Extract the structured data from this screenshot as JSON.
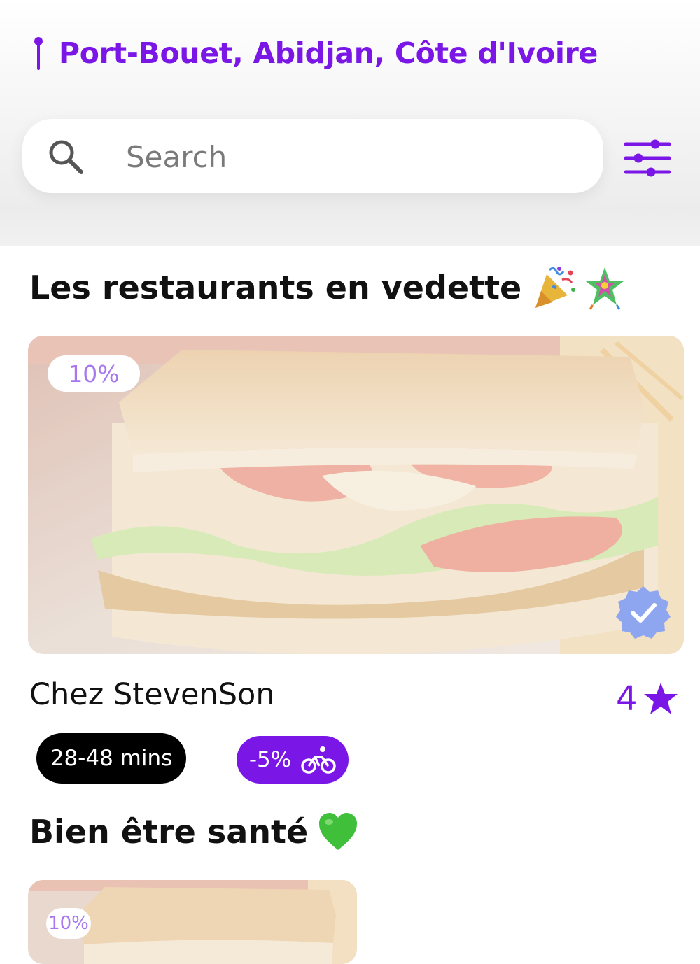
{
  "header": {
    "location": "Port-Bouet, Abidjan, Côte d'Ivoire",
    "location_icon": "pin-icon",
    "accent_color": "#7a16e6"
  },
  "search": {
    "placeholder": "Search",
    "value": "",
    "icon": "search-icon",
    "filter_icon": "sliders-icon"
  },
  "sections": [
    {
      "title": "Les restaurants en vedette",
      "emoji_icons": [
        "party-popper-icon",
        "pinata-icon"
      ],
      "restaurants": [
        {
          "name": "Chez StevenSon",
          "discount": "10%",
          "rating": "4",
          "rating_icon": "star-icon",
          "delivery_time": "28-48 mins",
          "delivery_promo": "-5%",
          "promo_icon": "bicycle-icon",
          "verified": true,
          "verified_icon": "verified-check-icon"
        }
      ]
    },
    {
      "title": "Bien être santé",
      "emoji_icons": [
        "green-heart-icon"
      ],
      "restaurants": [
        {
          "discount": "10%"
        }
      ]
    }
  ]
}
